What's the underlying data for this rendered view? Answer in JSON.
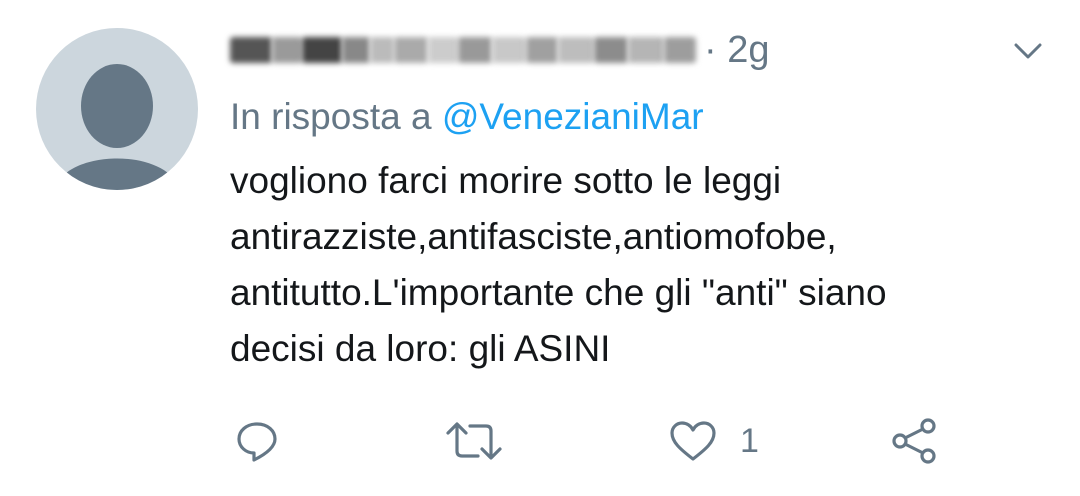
{
  "tweet": {
    "time": "· 2g",
    "reply_prefix": "In risposta a",
    "reply_mention": "@VenezianiMar",
    "text": "vogliono farci morire sotto le leggi\nantirazziste,antifasciste,antiomofobe,\nantitutto.L'importante che gli \"anti\" siano\ndecisi da loro: gli ASINI",
    "like_count": "1"
  },
  "icons": {
    "reply": "reply-icon",
    "retweet": "retweet-icon",
    "like": "heart-icon",
    "share": "share-icon",
    "menu": "chevron-down-icon"
  },
  "colors": {
    "mention": "#1da1f2",
    "secondary_text": "#657786",
    "body_text": "#14171a",
    "avatar_bg": "#ccd6dd",
    "avatar_fg": "#657786"
  }
}
